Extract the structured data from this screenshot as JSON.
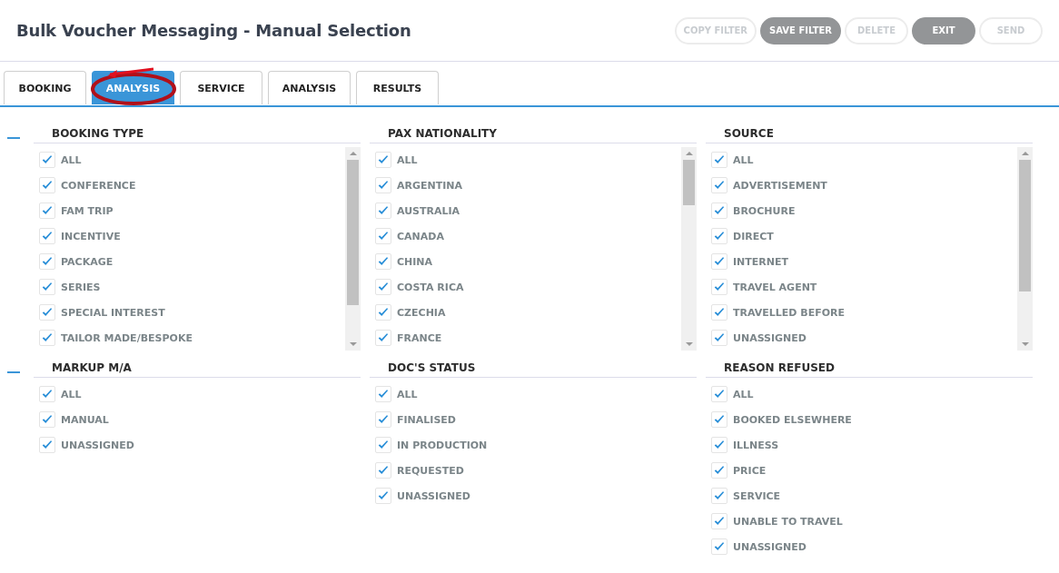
{
  "header": {
    "title": "Bulk Voucher Messaging - Manual Selection",
    "buttons": [
      {
        "label": "COPY FILTER",
        "disabled": true
      },
      {
        "label": "SAVE FILTER",
        "disabled": false
      },
      {
        "label": "DELETE",
        "disabled": true
      },
      {
        "label": "EXIT",
        "disabled": false
      },
      {
        "label": "SEND",
        "disabled": true
      }
    ]
  },
  "tabs": [
    {
      "label": "BOOKING",
      "selected": false
    },
    {
      "label": "ANALYSIS",
      "selected": true
    },
    {
      "label": "SERVICE",
      "selected": false
    },
    {
      "label": "ANALYSIS",
      "selected": false
    },
    {
      "label": "RESULTS",
      "selected": false
    }
  ],
  "sections": [
    {
      "expanded": true,
      "panels": [
        {
          "title": "BOOKING TYPE",
          "scrollable": true,
          "items": [
            {
              "label": "ALL",
              "checked": true
            },
            {
              "label": "CONFERENCE",
              "checked": true
            },
            {
              "label": "FAM TRIP",
              "checked": true
            },
            {
              "label": "INCENTIVE",
              "checked": true
            },
            {
              "label": "PACKAGE",
              "checked": true
            },
            {
              "label": "SERIES",
              "checked": true
            },
            {
              "label": "SPECIAL INTEREST",
              "checked": true
            },
            {
              "label": "TAILOR MADE/BESPOKE",
              "checked": true
            }
          ]
        },
        {
          "title": "PAX NATIONALITY",
          "scrollable": true,
          "items": [
            {
              "label": "ALL",
              "checked": true
            },
            {
              "label": "ARGENTINA",
              "checked": true
            },
            {
              "label": "AUSTRALIA",
              "checked": true
            },
            {
              "label": "CANADA",
              "checked": true
            },
            {
              "label": "CHINA",
              "checked": true
            },
            {
              "label": "COSTA RICA",
              "checked": true
            },
            {
              "label": "CZECHIA",
              "checked": true
            },
            {
              "label": "FRANCE",
              "checked": true
            }
          ]
        },
        {
          "title": "SOURCE",
          "scrollable": true,
          "items": [
            {
              "label": "ALL",
              "checked": true
            },
            {
              "label": "ADVERTISEMENT",
              "checked": true
            },
            {
              "label": "BROCHURE",
              "checked": true
            },
            {
              "label": "DIRECT",
              "checked": true
            },
            {
              "label": "INTERNET",
              "checked": true
            },
            {
              "label": "TRAVEL AGENT",
              "checked": true
            },
            {
              "label": "TRAVELLED BEFORE",
              "checked": true
            },
            {
              "label": "UNASSIGNED",
              "checked": true
            }
          ]
        }
      ]
    },
    {
      "expanded": true,
      "panels": [
        {
          "title": "MARKUP M/A",
          "scrollable": false,
          "items": [
            {
              "label": "ALL",
              "checked": true
            },
            {
              "label": "MANUAL",
              "checked": true
            },
            {
              "label": "UNASSIGNED",
              "checked": true
            }
          ]
        },
        {
          "title": "DOC'S STATUS",
          "scrollable": false,
          "items": [
            {
              "label": "ALL",
              "checked": true
            },
            {
              "label": "FINALISED",
              "checked": true
            },
            {
              "label": "IN PRODUCTION",
              "checked": true
            },
            {
              "label": "REQUESTED",
              "checked": true
            },
            {
              "label": "UNASSIGNED",
              "checked": true
            }
          ]
        },
        {
          "title": "REASON REFUSED",
          "scrollable": false,
          "items": [
            {
              "label": "ALL",
              "checked": true
            },
            {
              "label": "BOOKED ELSEWHERE",
              "checked": true
            },
            {
              "label": "ILLNESS",
              "checked": true
            },
            {
              "label": "PRICE",
              "checked": true
            },
            {
              "label": "SERVICE",
              "checked": true
            },
            {
              "label": "UNABLE TO TRAVEL",
              "checked": true
            },
            {
              "label": "UNASSIGNED",
              "checked": true
            }
          ]
        }
      ]
    }
  ]
}
